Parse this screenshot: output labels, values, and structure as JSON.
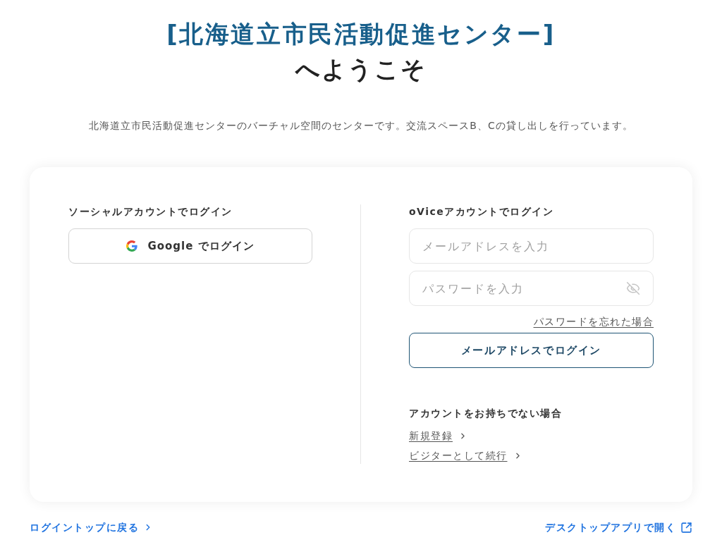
{
  "header": {
    "title": "[北海道立市民活動促進センター]",
    "subtitle": "へようこそ",
    "description": "北海道立市民活動促進センターのバーチャル空間のセンターです。交流スペースB、Cの貸し出しを行っています。"
  },
  "social_login": {
    "heading": "ソーシャルアカウントでログイン",
    "google_button": "Google でログイン"
  },
  "ovice_login": {
    "heading": "oViceアカウントでログイン",
    "email_field": {
      "placeholder": "メールアドレスを入力"
    },
    "password_field": {
      "placeholder": "パスワードを入力",
      "visible": false
    },
    "forgot_link": "パスワードを忘れた場合",
    "login_button": "メールアドレスでログイン"
  },
  "no_account": {
    "heading": "アカウントをお持ちでない場合",
    "links": [
      "新規登録",
      "ビジターとして続行"
    ]
  },
  "footer": {
    "back_link": "ログイントップに戻る",
    "desktop_link": "デスクトップアプリで開く"
  }
}
